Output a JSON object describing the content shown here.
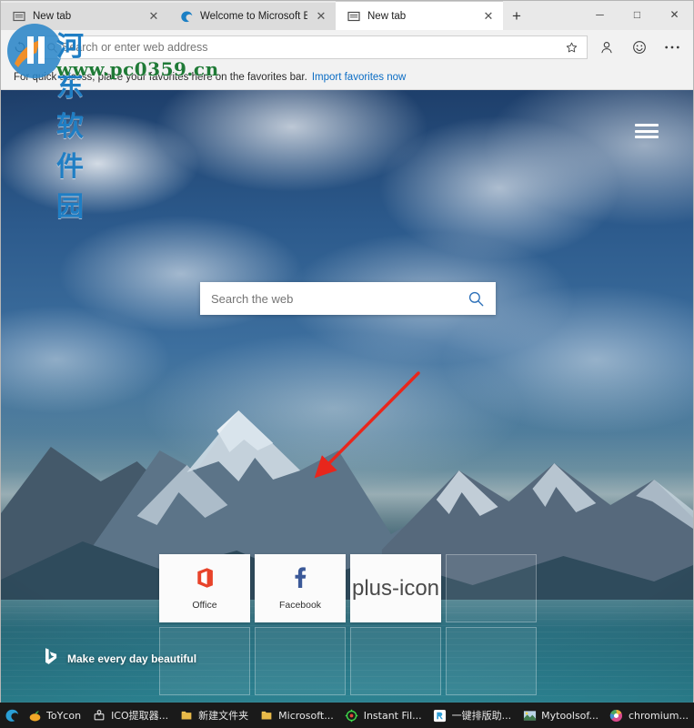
{
  "window": {
    "controls": {
      "minimize": "─",
      "maximize": "□",
      "close": "✕"
    }
  },
  "tabs": [
    {
      "title": "New tab",
      "favicon": "newtab-icon",
      "close": "✕",
      "active": false
    },
    {
      "title": "Welcome to Microsoft Edge De",
      "favicon": "edge-icon",
      "close": "✕",
      "active": false
    },
    {
      "title": "New tab",
      "favicon": "newtab-icon",
      "close": "✕",
      "active": true
    }
  ],
  "newtab_button": "+",
  "toolbar": {
    "refresh_icon": "refresh-icon",
    "address_placeholder": "Search or enter web address",
    "address_value": "",
    "star_icon": "star-icon",
    "profile_icon": "person-icon",
    "feedback_icon": "smiley-icon",
    "settings_icon": "ellipsis-icon"
  },
  "favorites_bar": {
    "message": "For quick access, place your favorites here on the favorites bar.",
    "link": "Import favorites now"
  },
  "newtab_page": {
    "hamburger_icon": "hamburger-icon",
    "search": {
      "placeholder": "Search the web",
      "value": "",
      "search_icon": "magnifier-icon"
    },
    "tiles": [
      {
        "label": "Office",
        "icon": "office-icon",
        "kind": "site"
      },
      {
        "label": "Facebook",
        "icon": "facebook-icon",
        "kind": "site"
      },
      {
        "label": "",
        "icon": "plus-icon",
        "kind": "add"
      },
      {
        "label": "",
        "icon": "",
        "kind": "empty"
      },
      {
        "label": "",
        "icon": "",
        "kind": "empty"
      },
      {
        "label": "",
        "icon": "",
        "kind": "empty"
      },
      {
        "label": "",
        "icon": "",
        "kind": "empty"
      },
      {
        "label": "",
        "icon": "",
        "kind": "empty"
      }
    ],
    "footer": {
      "logo": "bing-logo",
      "caption": "Make every day beautiful"
    }
  },
  "annotation": {
    "arrow": "red-arrow",
    "color": "#e8261c"
  },
  "watermark": {
    "site_name": "河东软件园",
    "url": "www.pc0359.cn"
  },
  "taskbar": {
    "items": [
      {
        "label": "ToYcon",
        "icon": "toycon-icon"
      },
      {
        "label": "ICO提取器...",
        "icon": "ico-extract-icon"
      },
      {
        "label": "新建文件夹",
        "icon": "folder-icon"
      },
      {
        "label": "Microsoft...",
        "icon": "folder-icon"
      },
      {
        "label": "Instant Fil...",
        "icon": "instant-file-icon"
      },
      {
        "label": "一键排版助...",
        "icon": "typeset-icon"
      },
      {
        "label": "Mytoolsof...",
        "icon": "mytools-icon"
      },
      {
        "label": "chromium...",
        "icon": "chromium-icon"
      }
    ]
  },
  "colors": {
    "accent": "#0a6cc4",
    "annotation_red": "#e8261c",
    "facebook_blue": "#3b5998",
    "office_orange": "#e8432a",
    "taskbar_bg": "#1a1a1a"
  }
}
